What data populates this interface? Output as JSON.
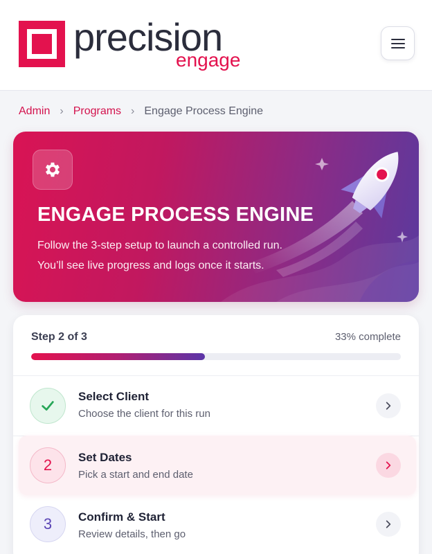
{
  "brand": {
    "name": "precision",
    "sub": "engage",
    "accent": "#e3124e"
  },
  "header": {
    "menu_icon": "hamburger-menu-icon"
  },
  "breadcrumb": {
    "items": [
      "Admin",
      "Programs"
    ],
    "current": "Engage Process Engine",
    "separator": "›"
  },
  "hero": {
    "icon": "gear-icon",
    "title": "ENGAGE PROCESS ENGINE",
    "line1": "Follow the 3-step setup to launch a controlled run.",
    "line2": "You’ll see live progress and logs once it starts.",
    "illustration": "rocket-icon"
  },
  "progress": {
    "step_label": "Step 2 of 3",
    "percent_label": "33% complete",
    "fill_fraction": 0.47
  },
  "steps": [
    {
      "status": "done",
      "badge": "✓",
      "title": "Select Client",
      "subtitle": "Choose the client for this run"
    },
    {
      "status": "current",
      "badge": "2",
      "title": "Set Dates",
      "subtitle": "Pick a start and end date"
    },
    {
      "status": "todo",
      "badge": "3",
      "title": "Confirm & Start",
      "subtitle": "Review details, then go"
    }
  ]
}
